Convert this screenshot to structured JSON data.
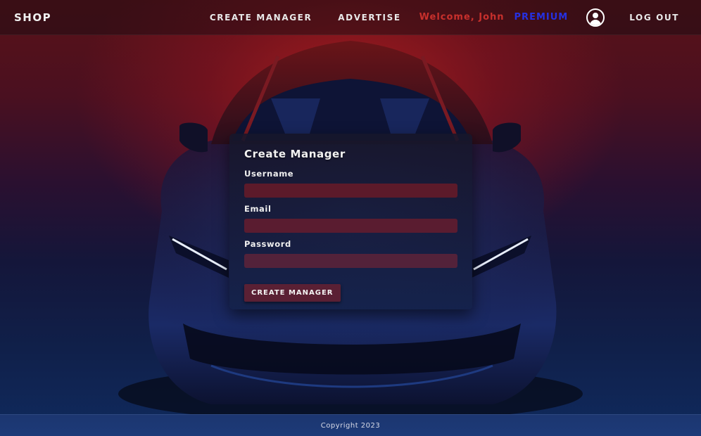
{
  "nav": {
    "brand": "SHOP",
    "links": [
      "CREATE MANAGER",
      "ADVERTISE"
    ],
    "welcome": "Welcome, John",
    "plan": "PREMIUM",
    "logout": "LOG OUT"
  },
  "form": {
    "title": "Create Manager",
    "username_label": "Username",
    "username_value": "",
    "email_label": "Email",
    "email_value": "",
    "password_label": "Password",
    "password_value": "",
    "submit_label": "CREATE MANAGER"
  },
  "footer": {
    "copyright": "Copyright 2023"
  },
  "icons": {
    "account": "user-avatar-icon"
  },
  "colors": {
    "welcome": "#c8302c",
    "premium": "#2630e0",
    "input_bg": "#5c1a2a",
    "button_bg": "#5a2034"
  }
}
